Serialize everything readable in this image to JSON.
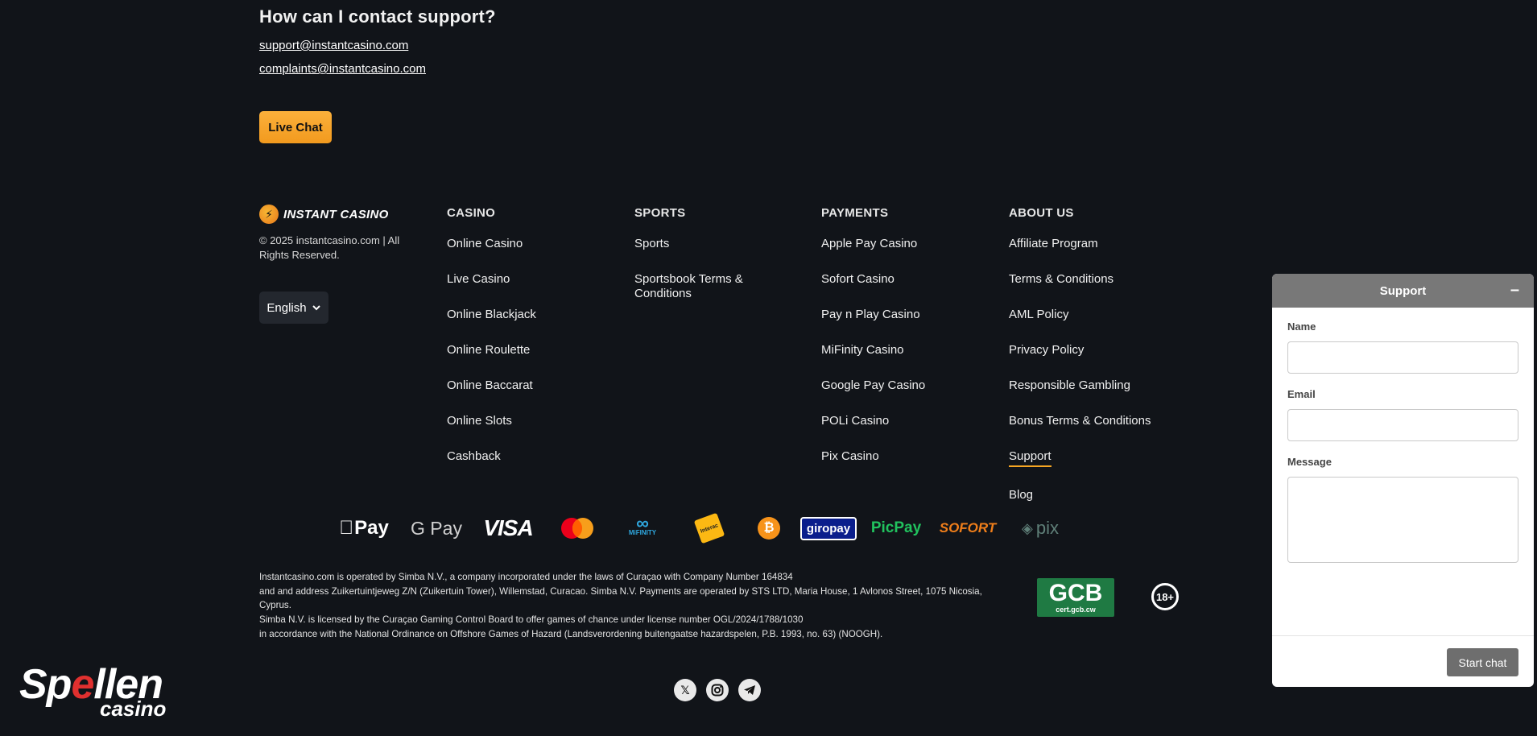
{
  "contact": {
    "title": "How can I contact support?",
    "email_support": "support@instantcasino.com",
    "email_complaints": "complaints@instantcasino.com",
    "live_chat_label": "Live Chat"
  },
  "brand": {
    "logo_text": "INSTANT CASINO",
    "copyright": "© 2025 instantcasino.com | All Rights Reserved.",
    "language": "English"
  },
  "columns": [
    {
      "heading": "CASINO",
      "items": [
        "Online Casino",
        "Live Casino",
        "Online Blackjack",
        "Online Roulette",
        "Online Baccarat",
        "Online Slots",
        "Cashback"
      ]
    },
    {
      "heading": "SPORTS",
      "items": [
        "Sports",
        "Sportsbook Terms & Conditions"
      ]
    },
    {
      "heading": "PAYMENTS",
      "items": [
        "Apple Pay Casino",
        "Sofort Casino",
        "Pay n Play Casino",
        "MiFinity Casino",
        "Google Pay Casino",
        "POLi Casino",
        "Pix Casino"
      ]
    },
    {
      "heading": "ABOUT US",
      "items": [
        "Affiliate Program",
        "Terms & Conditions",
        "AML Policy",
        "Privacy Policy",
        "Responsible Gambling",
        "Bonus Terms & Conditions",
        "Support",
        "Blog"
      ]
    }
  ],
  "payment_logos": [
    {
      "icon": "apple-pay-icon",
      "text": "Pay"
    },
    {
      "icon": "google-pay-icon",
      "text": "G Pay"
    },
    {
      "icon": "visa-icon",
      "text": "VISA"
    },
    {
      "icon": "mastercard-icon",
      "text": ""
    },
    {
      "icon": "mifinity-icon",
      "text": "MiFINITY"
    },
    {
      "icon": "interac-icon",
      "text": "Interac"
    },
    {
      "icon": "bitcoin-icon",
      "text": "₿"
    },
    {
      "icon": "giropay-icon",
      "text": "giropay"
    },
    {
      "icon": "picpay-icon",
      "text": "PicPay"
    },
    {
      "icon": "sofort-icon",
      "text": "SOFORT"
    },
    {
      "icon": "pix-icon",
      "text": "pix"
    }
  ],
  "legal": {
    "line1": "Instantcasino.com is operated by Simba N.V., a company incorporated under the laws of Curaçao with Company Number 164834",
    "line2": "and and address Zuikertuintjeweg Z/N (Zuikertuin Tower), Willemstad, Curacao. Simba N.V. Payments are operated by STS LTD, Maria House, 1 Avlonos Street, 1075 Nicosia, Cyprus.",
    "line3": "Simba N.V. is licensed by the Curaçao Gaming Control Board to offer games of chance under license number OGL/2024/1788/1030",
    "line4": "in accordance with the National Ordinance on Offshore Games of Hazard (Landsverordening buitengaatse hazardspelen, P.B. 1993, no. 63) (NOOGH)."
  },
  "badges": {
    "gcb_big": "GCB",
    "gcb_small": "cert.gcb.cw",
    "age": "18+"
  },
  "watermark": {
    "top_pre": "Sp",
    "top_e": "e",
    "top_post": "llen",
    "bottom": "casino"
  },
  "support_widget": {
    "title": "Support",
    "minimize": "–",
    "name_label": "Name",
    "email_label": "Email",
    "message_label": "Message",
    "start_chat_label": "Start chat"
  },
  "colors": {
    "background": "#111419",
    "accent": "#f7a623",
    "widget_header": "#787878"
  }
}
